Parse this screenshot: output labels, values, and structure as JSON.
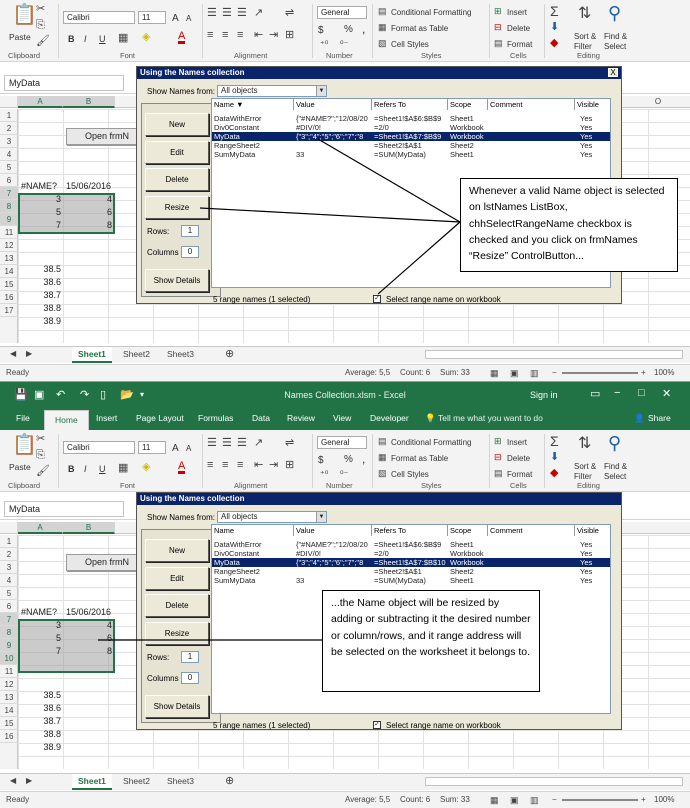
{
  "excel": {
    "file_title": "Names Collection.xlsm - Excel",
    "sign_in": "Sign in",
    "share": "Share",
    "tabs": [
      "File",
      "Home",
      "Insert",
      "Page Layout",
      "Formulas",
      "Data",
      "Review",
      "View",
      "Developer"
    ],
    "tell_me": "Tell me what you want to do",
    "ribbon": {
      "paste": "Paste",
      "clipboard": "Clipboard",
      "font_name": "Calibri",
      "font_size": "11",
      "font_group": "Font",
      "alignment_group": "Alignment",
      "number_format": "General",
      "number_group": "Number",
      "conditional_formatting": "Conditional Formatting",
      "format_as_table": "Format as Table",
      "cell_styles": "Cell Styles",
      "styles_group": "Styles",
      "insert": "Insert",
      "delete": "Delete",
      "format": "Format",
      "cells_group": "Cells",
      "sort_filter": "Sort &",
      "sort_filter2": "Filter",
      "find_select": "Find &",
      "find_select2": "Select",
      "editing_group": "Editing",
      "bold": "B",
      "italic": "I",
      "underline": "U",
      "grow": "A",
      "shrink": "A",
      "pct": "%",
      "comma": ",",
      "dollar": "$"
    },
    "name_box": "MyData",
    "columns": [
      "A",
      "B",
      "O"
    ],
    "rows": [
      "1",
      "2",
      "3",
      "4",
      "5",
      "6",
      "7",
      "8",
      "9",
      "10",
      "11",
      "12",
      "13",
      "14",
      "15",
      "16",
      "17"
    ],
    "cells": {
      "open_button": "Open frmN",
      "a6": "#NAME?",
      "b6": "15/06/2016",
      "a7": "3",
      "b7": "4",
      "a8": "5",
      "b8": "6",
      "a9": "7",
      "b9": "8",
      "a12": "38.5",
      "a13": "38.6",
      "a14": "38.7",
      "a15": "38.8",
      "a16": "38.9"
    },
    "sheets": [
      "Sheet1",
      "Sheet2",
      "Sheet3"
    ],
    "add_sheet": "⊕",
    "status": {
      "ready": "Ready",
      "average": "Average: 5,5",
      "count": "Count: 6",
      "sum": "Sum: 33",
      "zoom": "100%"
    }
  },
  "dialog": {
    "title": "Using the Names collection",
    "close": "X",
    "show_names_label": "Show Names from:",
    "show_names_value": "All objects",
    "buttons": {
      "new": "New",
      "edit": "Edit",
      "delete": "Delete",
      "resize": "Resize",
      "show_details": "Show Details"
    },
    "rows_label": "Rows:",
    "rows_value": "1",
    "columns_label": "Columns",
    "columns_value": "0",
    "headers": [
      "Name",
      "Value",
      "Refers To",
      "Scope",
      "Comment",
      "Visible"
    ],
    "status": "5 range names (1 selected)",
    "select_range_label": "Select range name on workbook",
    "check": "✓"
  },
  "names_top": [
    {
      "name": "DataWithError",
      "value": "{\"#NAME?\";\"12/08/20",
      "refers": "=Sheet1!$A$6:$B$9",
      "scope": "Sheet1",
      "visible": "Yes"
    },
    {
      "name": "Div0Constant",
      "value": "#DIV/0!",
      "refers": "=2/0",
      "scope": "Workbook",
      "visible": "Yes"
    },
    {
      "name": "MyData",
      "value": "{\"3\";\"4\";\"5\";\"6\";\"7\";\"8",
      "refers": "=Sheet1!$A$7:$B$9",
      "scope": "Workbook",
      "visible": "Yes"
    },
    {
      "name": "RangeSheet2",
      "value": "",
      "refers": "=Sheet2!$A$1",
      "scope": "Sheet2",
      "visible": "Yes"
    },
    {
      "name": "SumMyData",
      "value": "33",
      "refers": "=SUM(MyData)",
      "scope": "Sheet1",
      "visible": "Yes"
    }
  ],
  "names_bottom": [
    {
      "name": "DataWithError",
      "value": "{\"#NAME?\";\"12/08/20",
      "refers": "=Sheet1!$A$6:$B$9",
      "scope": "Sheet1",
      "visible": "Yes"
    },
    {
      "name": "Div0Constant",
      "value": "#DIV/0!",
      "refers": "=2/0",
      "scope": "Workbook",
      "visible": "Yes"
    },
    {
      "name": "MyData",
      "value": "{\"3\";\"4\";\"5\";\"6\";\"7\";\"8",
      "refers": "=Sheet1!$A$7:$B$10",
      "scope": "Workbook",
      "visible": "Yes"
    },
    {
      "name": "RangeSheet2",
      "value": "",
      "refers": "=Sheet2!$A$1",
      "scope": "Sheet2",
      "visible": "Yes"
    },
    {
      "name": "SumMyData",
      "value": "33",
      "refers": "=SUM(MyData)",
      "scope": "Sheet1",
      "visible": "Yes"
    }
  ],
  "callout_top": "Whenever a valid Name object is selected on lstNames ListBox, chhSelectRangeName checkbox is checked and you click on frmNames “Resize” ControlButton...",
  "callout_bottom": "...the Name object will be resized by adding or subtracting it the desired number or column/rows, and it range address will be selected on the worksheet it belongs to.",
  "colors": {
    "excel_green": "#217346",
    "dialog_title": "#0a246a",
    "dialog_bg": "#ece9d8"
  }
}
